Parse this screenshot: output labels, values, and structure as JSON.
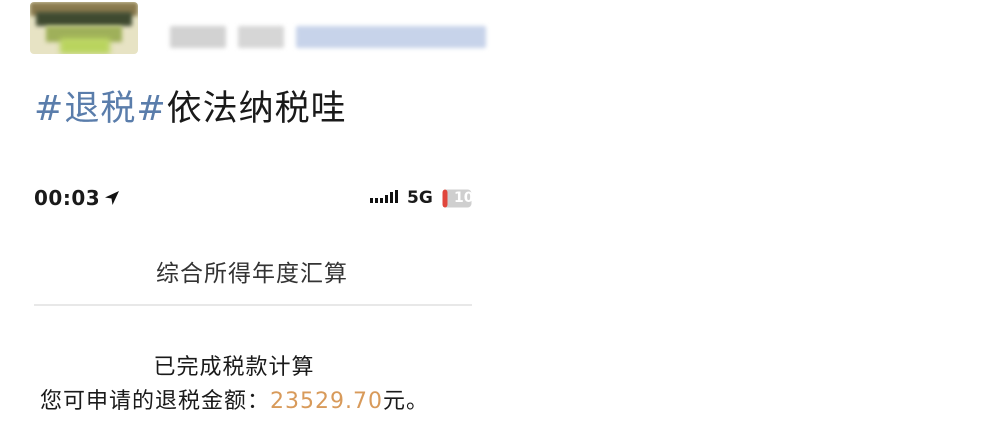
{
  "post": {
    "author_blurred": true,
    "hashtag": "#退税#",
    "text": "依法纳税哇",
    "hashtag_color": "#5a7dab"
  },
  "phone_screenshot": {
    "status_bar": {
      "time": "00:03",
      "location_icon": "location-arrow-icon",
      "signal_icon": "signal-bars-icon",
      "network": "5G",
      "battery_level": "10",
      "battery_icon": "battery-icon"
    },
    "page_title": "综合所得年度汇算",
    "status_text": "已完成税款计算",
    "refund": {
      "label": "您可申请的退税金额：",
      "amount": "23529.70",
      "unit_suffix": "元。",
      "amount_color": "#d89a5a"
    }
  }
}
